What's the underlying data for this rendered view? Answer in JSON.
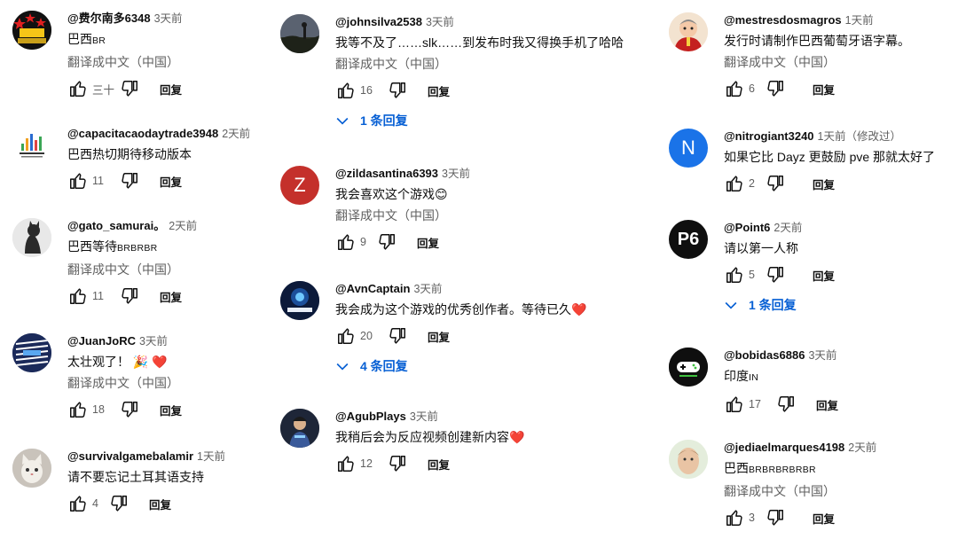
{
  "comments": {
    "c1": {
      "author": "@费尔南多6348",
      "time": "3天前",
      "text": "巴西",
      "text_small": "BR",
      "translate": "翻译成中文（中国）",
      "likes": "三十",
      "reply": "回复",
      "avatar_icon": "star-logo-avatar"
    },
    "c2": {
      "author": "@capacitacaodaytrade3948",
      "time": "2天前",
      "text": "巴西热切期待移动版本",
      "likes": "11",
      "reply": "回复",
      "avatar_icon": "chart-logo-avatar"
    },
    "c3": {
      "author": "@gato_samurai。",
      "time": "2天前",
      "text": "巴西等待",
      "text_small": "BRBRBR",
      "translate": "翻译成中文（中国）",
      "likes": "11",
      "reply": "回复",
      "avatar_icon": "cat-photo-avatar"
    },
    "c4": {
      "author": "@JuanJoRC",
      "time": "3天前",
      "text": "太壮观了！ 🎉 ❤️",
      "translate": "翻译成中文（中国）",
      "likes": "18",
      "reply": "回复",
      "avatar_icon": "stripes-avatar"
    },
    "c5": {
      "author": "@survivalgamebalamir",
      "time": "1天前",
      "text": "请不要忘记土耳其语支持",
      "likes": "4",
      "reply": "回复",
      "avatar_icon": "kitten-photo-avatar"
    },
    "c6": {
      "author": "@johnsilva2538",
      "time": "3天前",
      "text": "我等不及了……slk……到发布时我又得换手机了哈哈",
      "translate": "翻译成中文（中国）",
      "likes": "16",
      "reply": "回复",
      "replies": "1 条回复",
      "avatar_icon": "landscape-photo-avatar"
    },
    "c7": {
      "author": "@zildasantina6393",
      "time": "3天前",
      "text": "我会喜欢这个游戏😊",
      "translate": "翻译成中文（中国）",
      "likes": "9",
      "reply": "回复",
      "avatar_letter": "Z"
    },
    "c8": {
      "author": "@AvnCaptain",
      "time": "3天前",
      "text": "我会成为这个游戏的优秀创作者。等待已久❤️",
      "likes": "20",
      "reply": "回复",
      "replies": "4 条回复",
      "avatar_icon": "game-logo-avatar"
    },
    "c9": {
      "author": "@AgubPlays",
      "time": "3天前",
      "text": "我稍后会为反应视频创建新内容❤️",
      "likes": "12",
      "reply": "回复",
      "avatar_icon": "character-avatar"
    },
    "c10": {
      "author": "@mestresdosmagros",
      "time": "1天前",
      "text": "发行时请制作巴西葡萄牙语字幕。",
      "translate": "翻译成中文（中国）",
      "likes": "6",
      "reply": "回复",
      "avatar_icon": "cartoon-avatar"
    },
    "c11": {
      "author": "@nitrogiant3240",
      "time": "1天前（修改过）",
      "text": "如果它比 Dayz 更鼓励 pve 那就太好了",
      "likes": "2",
      "reply": "回复",
      "avatar_letter": "N"
    },
    "c12": {
      "author": "@Point6",
      "time": "2天前",
      "text": "请以第一人称",
      "likes": "5",
      "reply": "回复",
      "replies": "1 条回复",
      "avatar_letter": "P6"
    },
    "c13": {
      "author": "@bobidas6886",
      "time": "3天前",
      "text": "印度",
      "text_small": "IN",
      "likes": "17",
      "reply": "回复",
      "avatar_icon": "gamepad-logo-avatar"
    },
    "c14": {
      "author": "@jediaelmarques4198",
      "time": "2天前",
      "text": "巴西",
      "text_small": "BRBRBRBRBR",
      "translate": "翻译成中文（中国）",
      "likes": "3",
      "reply": "回复",
      "avatar_icon": "face-photo-avatar"
    }
  },
  "colors": {
    "link": "#065fd4",
    "secondary": "#606060",
    "zilda": "#c4302b",
    "nitro": "#1a73e8",
    "point6": "#0f0f0f"
  }
}
